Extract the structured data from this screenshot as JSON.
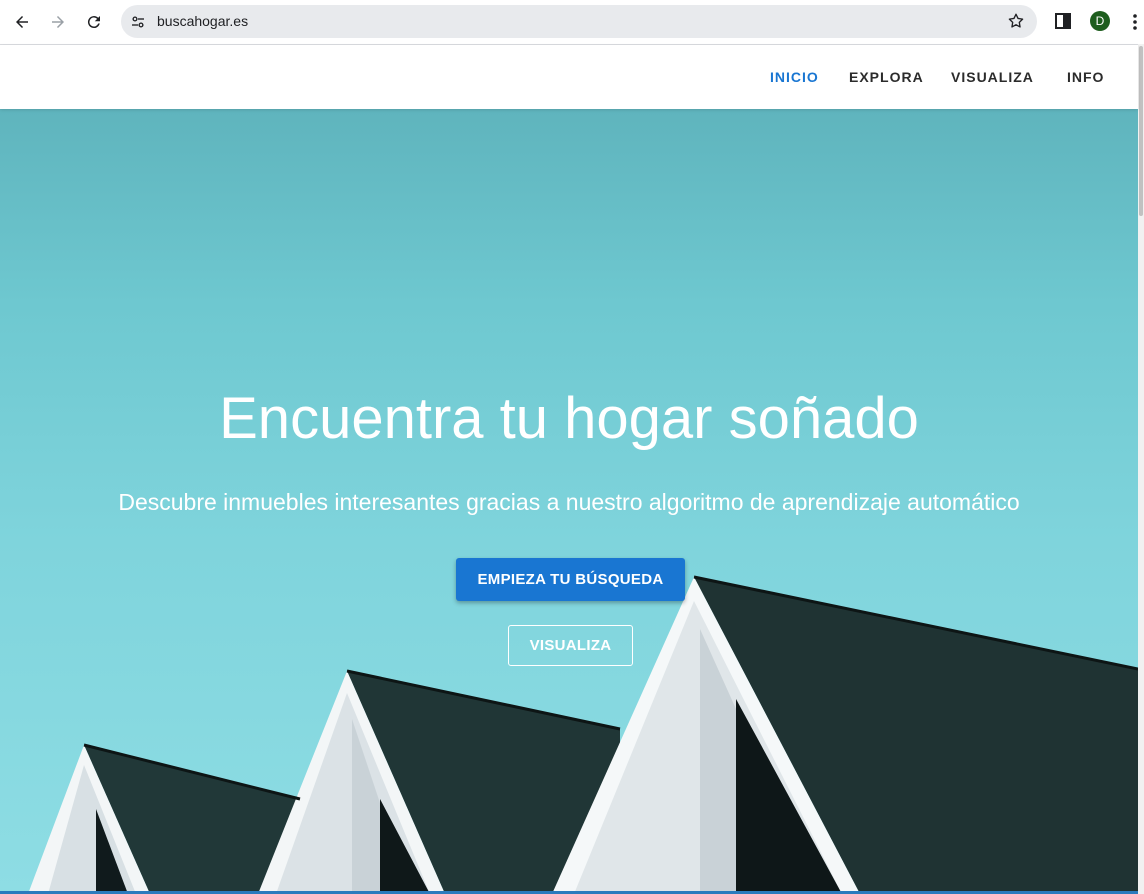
{
  "browser": {
    "url": "buscahogar.es",
    "avatar_letter": "D",
    "icons": [
      "back-arrow-icon",
      "forward-arrow-icon",
      "reload-icon",
      "site-settings-icon",
      "bookmark-star-icon",
      "side-panel-icon",
      "menu-dots-icon"
    ]
  },
  "nav": {
    "items": [
      {
        "label": "INICIO",
        "active": true
      },
      {
        "label": "EXPLORA",
        "active": false
      },
      {
        "label": "VISUALIZA",
        "active": false
      },
      {
        "label": "INFO",
        "active": false
      }
    ]
  },
  "hero": {
    "title": "Encuentra tu hogar soñado",
    "subtitle": "Descubre inmuebles interesantes gracias a nuestro algoritmo de aprendizaje automático",
    "primary_button": "EMPIEZA TU BÚSQUEDA",
    "secondary_button": "VISUALIZA"
  },
  "colors": {
    "accent": "#1976d2",
    "sky": "#7fd4dc",
    "roof": "#1f3333",
    "wall": "#dfe6ea"
  }
}
